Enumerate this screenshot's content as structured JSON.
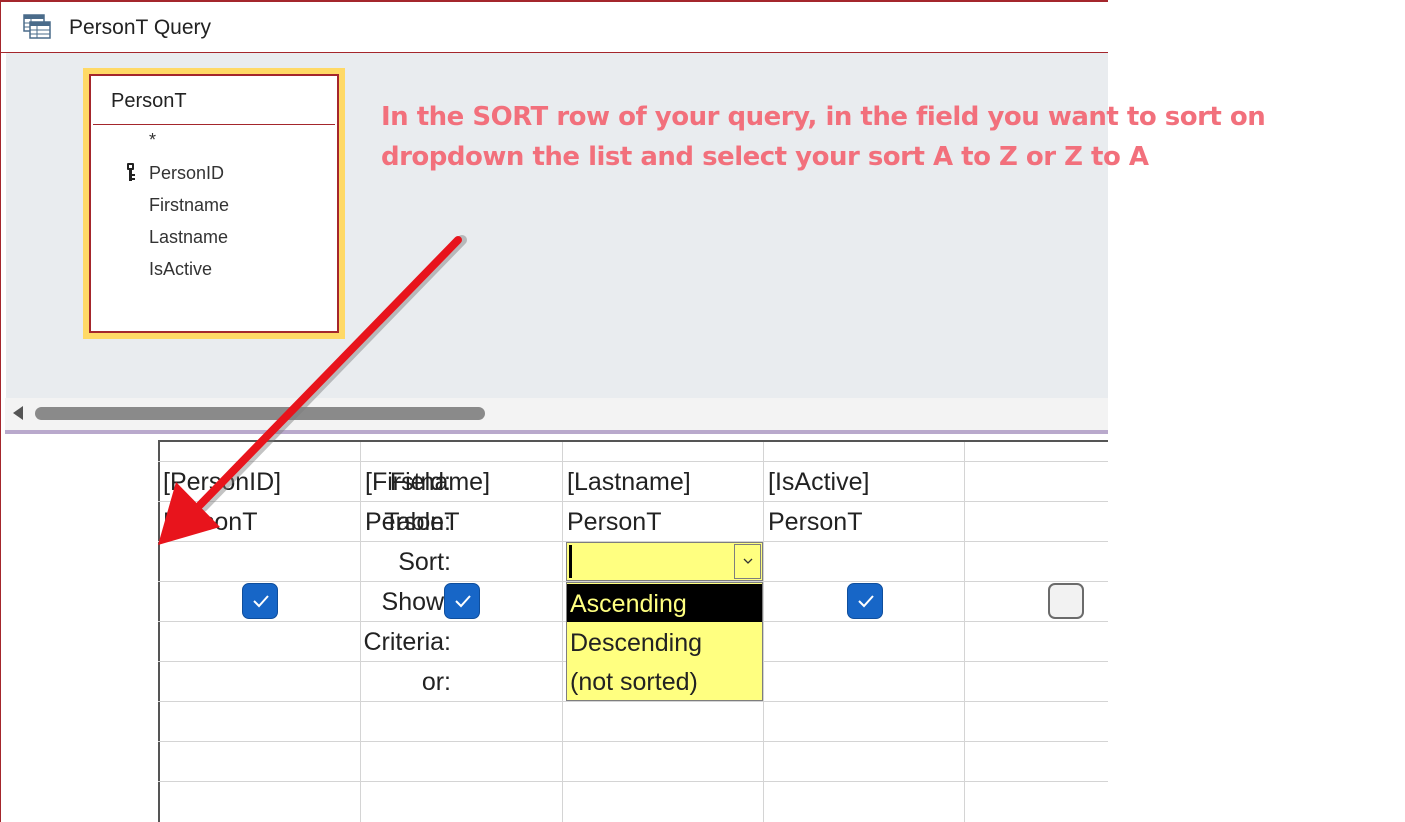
{
  "window": {
    "title": "PersonT Query"
  },
  "table_box": {
    "title": "PersonT",
    "fields": [
      "*",
      "PersonID",
      "Firstname",
      "Lastname",
      "IsActive"
    ]
  },
  "instruction": {
    "line1": "In the SORT row of your query, in the field you want to sort on",
    "line2": "dropdown the list and select your sort A to Z or Z to A"
  },
  "grid": {
    "row_labels": [
      "Field:",
      "Table:",
      "Sort:",
      "Show:",
      "Criteria:",
      "or:"
    ],
    "columns": [
      {
        "field": "[PersonID]",
        "table": "PersonT",
        "show": true
      },
      {
        "field": "[Firstname]",
        "table": "PersonT",
        "show": true
      },
      {
        "field": "[Lastname]",
        "table": "PersonT",
        "show": true
      },
      {
        "field": "[IsActive]",
        "table": "PersonT",
        "show": true
      },
      {
        "field": "",
        "table": "",
        "show": false
      }
    ]
  },
  "sort_dropdown": {
    "current_value": "",
    "options": [
      "Ascending",
      "Descending",
      "(not sorted)"
    ],
    "highlighted": "Ascending"
  },
  "colors": {
    "accent": "#a4262c",
    "annotation_text": "#f2707c",
    "annotation_arrow": "#e8141c",
    "checkbox": "#1766c7",
    "combo_background": "#ffff80"
  }
}
